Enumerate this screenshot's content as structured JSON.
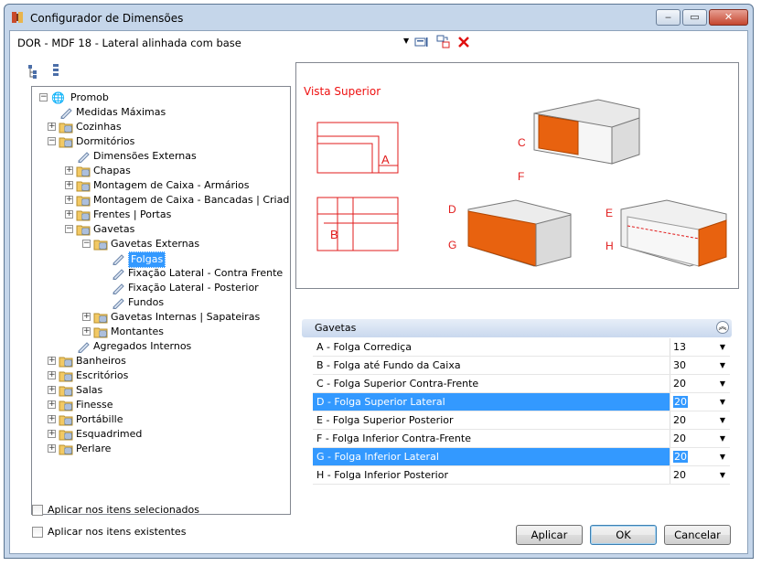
{
  "window": {
    "title": "Configurador de Dimensões",
    "controls": {
      "minimize": "‒",
      "maximize": "▭",
      "close": "✕"
    }
  },
  "selector": {
    "value": "DOR - MDF 18 - Lateral alinhada com base"
  },
  "tree": {
    "root": "Promob",
    "nodes": [
      {
        "label": "Medidas Máximas"
      },
      {
        "label": "Cozinhas"
      },
      {
        "label": "Dormitórios"
      },
      {
        "label": "Dimensões Externas"
      },
      {
        "label": "Chapas"
      },
      {
        "label": "Montagem de Caixa - Armários"
      },
      {
        "label": "Montagem de Caixa - Bancadas | Criados"
      },
      {
        "label": "Frentes | Portas"
      },
      {
        "label": "Gavetas"
      },
      {
        "label": "Gavetas Externas"
      },
      {
        "label": "Folgas"
      },
      {
        "label": "Fixação Lateral - Contra Frente"
      },
      {
        "label": "Fixação Lateral - Posterior"
      },
      {
        "label": "Fundos"
      },
      {
        "label": "Gavetas Internas | Sapateiras"
      },
      {
        "label": "Montantes"
      },
      {
        "label": "Agregados Internos"
      },
      {
        "label": "Banheiros"
      },
      {
        "label": "Escritórios"
      },
      {
        "label": "Salas"
      },
      {
        "label": "Finesse"
      },
      {
        "label": "Portábille"
      },
      {
        "label": "Esquadrimed"
      },
      {
        "label": "Perlare"
      }
    ]
  },
  "preview": {
    "heading": "Vista Superior",
    "letters": {
      "a": "A",
      "b": "B",
      "c": "C",
      "f": "F",
      "d": "D",
      "g": "G",
      "e": "E",
      "h": "H"
    },
    "accent": "#e8620f",
    "line_color": "#e11b1b"
  },
  "properties": {
    "group": "Gavetas",
    "rows": [
      {
        "name": "A - Folga Corrediça",
        "value": "13",
        "selected": false
      },
      {
        "name": "B - Folga até Fundo da Caixa",
        "value": "30",
        "selected": false
      },
      {
        "name": "C - Folga Superior Contra-Frente",
        "value": "20",
        "selected": false
      },
      {
        "name": "D - Folga Superior Lateral",
        "value": "20",
        "selected": true
      },
      {
        "name": "E - Folga Superior Posterior",
        "value": "20",
        "selected": false
      },
      {
        "name": "F - Folga Inferior Contra-Frente",
        "value": "20",
        "selected": false
      },
      {
        "name": "G - Folga Inferior Lateral",
        "value": "20",
        "selected": true
      },
      {
        "name": "H - Folga Inferior Posterior",
        "value": "20",
        "selected": false
      }
    ],
    "selection_color": "#3399ff"
  },
  "options": {
    "apply_selected": "Aplicar nos itens selecionados",
    "apply_existing": "Aplicar nos itens existentes"
  },
  "buttons": {
    "apply": "Aplicar",
    "ok": "OK",
    "cancel": "Cancelar"
  }
}
